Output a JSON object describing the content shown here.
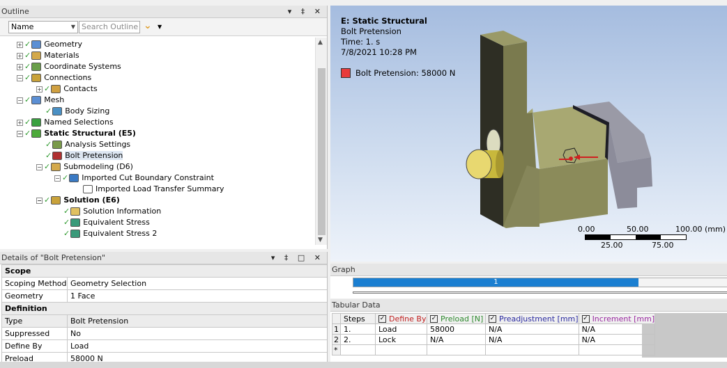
{
  "outline": {
    "title": "Outline",
    "controls": "▾ ‡ ✕",
    "name_select": "Name",
    "search_placeholder": "Search Outline",
    "tree": [
      {
        "label": "Geometry",
        "indent": 0,
        "expander": "+",
        "bold": false,
        "icon_color": "#5b8fd4"
      },
      {
        "label": "Materials",
        "indent": 0,
        "expander": "+",
        "bold": false,
        "icon_color": "#d4a94b"
      },
      {
        "label": "Coordinate Systems",
        "indent": 0,
        "expander": "+",
        "bold": false,
        "icon_color": "#6a9f4a"
      },
      {
        "label": "Connections",
        "indent": 0,
        "expander": "−",
        "bold": false,
        "icon_color": "#c9a23a"
      },
      {
        "label": "Contacts",
        "indent": 1,
        "expander": "+",
        "bold": false,
        "icon_color": "#d0a040"
      },
      {
        "label": "Mesh",
        "indent": 0,
        "expander": "−",
        "bold": false,
        "icon_color": "#5b8fd4"
      },
      {
        "label": "Body Sizing",
        "indent": 1,
        "expander": "",
        "bold": false,
        "icon_color": "#4a90c4"
      },
      {
        "label": "Named Selections",
        "indent": 0,
        "expander": "+",
        "bold": false,
        "icon_color": "#3aa040"
      },
      {
        "label": "Static Structural (E5)",
        "indent": 0,
        "expander": "−",
        "bold": true,
        "icon_color": "#4caa3a"
      },
      {
        "label": "Analysis Settings",
        "indent": 1,
        "expander": "",
        "bold": false,
        "icon_color": "#7a9a4a"
      },
      {
        "label": "Bolt Pretension",
        "indent": 1,
        "expander": "",
        "bold": false,
        "icon_color": "#b03030",
        "selected": true
      },
      {
        "label": "Submodeling (D6)",
        "indent": 1,
        "expander": "−",
        "bold": false,
        "icon_color": "#d4a94b"
      },
      {
        "label": "Imported Cut Boundary Constraint",
        "indent": 2,
        "expander": "−",
        "bold": false,
        "icon_color": "#3a7ac4"
      },
      {
        "label": "Imported Load Transfer Summary",
        "indent": 3,
        "expander": "",
        "bold": false,
        "icon_color": "#ffffff",
        "nocheck": true
      },
      {
        "label": "Solution (E6)",
        "indent": 1,
        "expander": "−",
        "bold": true,
        "icon_color": "#c9a23a"
      },
      {
        "label": "Solution Information",
        "indent": 2,
        "expander": "",
        "bold": false,
        "icon_color": "#e0c060"
      },
      {
        "label": "Equivalent Stress",
        "indent": 2,
        "expander": "",
        "bold": false,
        "icon_color": "#3a9a7a"
      },
      {
        "label": "Equivalent Stress 2",
        "indent": 2,
        "expander": "",
        "bold": false,
        "icon_color": "#3a9a7a"
      }
    ]
  },
  "details": {
    "title": "Details of \"Bolt Pretension\"",
    "controls": "▾ ‡ □ ✕",
    "rows": [
      {
        "section": "Scope"
      },
      {
        "key": "Scoping Method",
        "value": "Geometry Selection"
      },
      {
        "key": "Geometry",
        "value": "1 Face"
      },
      {
        "section": "Definition"
      },
      {
        "key": "Type",
        "value": "Bolt Pretension",
        "hl": true
      },
      {
        "key": "Suppressed",
        "value": "No"
      },
      {
        "key": "Define By",
        "value": "Load"
      },
      {
        "key": "Preload",
        "value": "58000 N"
      }
    ]
  },
  "viewport": {
    "title": "E: Static Structural",
    "subtitle": "Bolt Pretension",
    "time": "Time: 1. s",
    "date": "7/8/2021 10:28 PM",
    "legend_label": "Bolt Pretension: 58000 N",
    "legend_color": "#e83a3a",
    "scale": {
      "top_labels": [
        "0.00",
        "50.00",
        "100.00 (mm)"
      ],
      "bottom_labels": [
        "25.00",
        "75.00"
      ]
    }
  },
  "graph": {
    "title": "Graph",
    "step_label": "1",
    "fill_fraction": 0.76
  },
  "tabular": {
    "title": "Tabular Data",
    "headers": [
      {
        "label": "Steps",
        "checkbox": false,
        "color": "#000000"
      },
      {
        "label": "Define By",
        "checkbox": true,
        "color": "#c02020"
      },
      {
        "label": "Preload [N]",
        "checkbox": true,
        "color": "#2e8a2e"
      },
      {
        "label": "Preadjustment [mm]",
        "checkbox": true,
        "color": "#2a2aa0"
      },
      {
        "label": "Increment [mm]",
        "checkbox": true,
        "color": "#9a2aa0"
      }
    ],
    "rows": [
      {
        "num": "1",
        "cells": [
          "1.",
          "Load",
          "58000",
          "N/A",
          "N/A"
        ]
      },
      {
        "num": "2",
        "cells": [
          "2.",
          "Lock",
          "N/A",
          "N/A",
          "N/A"
        ]
      },
      {
        "num": "*",
        "cells": [
          "",
          "",
          "",
          "",
          ""
        ]
      }
    ]
  }
}
